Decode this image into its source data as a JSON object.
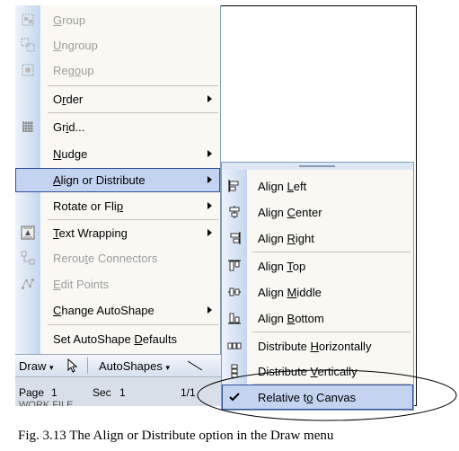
{
  "menu": {
    "items": [
      {
        "label": "Group",
        "key": "G",
        "icon": "group-icon",
        "disabled": true
      },
      {
        "label": "Ungroup",
        "key": "U",
        "icon": "ungroup-icon",
        "disabled": true
      },
      {
        "label": "Regroup",
        "key": "o",
        "icon": "regroup-icon",
        "disabled": true
      },
      {
        "label": "Order",
        "key": "r",
        "submenu": true
      },
      {
        "label": "Grid...",
        "key": "i",
        "icon": "grid-icon"
      },
      {
        "label": "Nudge",
        "key": "N",
        "submenu": true
      },
      {
        "label": "Align or Distribute",
        "key": "A",
        "submenu": true,
        "selected": true
      },
      {
        "label": "Rotate or Flip",
        "key": "p",
        "submenu": true
      },
      {
        "label": "Text Wrapping",
        "key": "T",
        "icon": "text-wrapping-icon",
        "submenu": true
      },
      {
        "label": "Reroute Connectors",
        "key": "t",
        "icon": "reroute-connectors-icon",
        "disabled": true
      },
      {
        "label": "Edit Points",
        "key": "E",
        "icon": "edit-points-icon",
        "disabled": true
      },
      {
        "label": "Change AutoShape",
        "key": "C",
        "submenu": true
      },
      {
        "label": "Set AutoShape Defaults",
        "key": "D"
      }
    ]
  },
  "submenu": {
    "items": [
      {
        "label": "Align Left",
        "key": "L",
        "icon": "align-left-icon"
      },
      {
        "label": "Align Center",
        "key": "C",
        "icon": "align-center-icon"
      },
      {
        "label": "Align Right",
        "key": "R",
        "icon": "align-right-icon"
      },
      {
        "label": "Align Top",
        "key": "T",
        "icon": "align-top-icon"
      },
      {
        "label": "Align Middle",
        "key": "M",
        "icon": "align-middle-icon"
      },
      {
        "label": "Align Bottom",
        "key": "B",
        "icon": "align-bottom-icon"
      },
      {
        "label": "Distribute Horizontally",
        "key": "H",
        "icon": "distribute-horizontally-icon"
      },
      {
        "label": "Distribute Vertically",
        "key": "V",
        "icon": "distribute-vertically-icon"
      },
      {
        "label": "Relative to Canvas",
        "key": "o",
        "icon": "checkmark-icon",
        "selected": true
      }
    ]
  },
  "toolbar": {
    "draw_label": "Draw",
    "autoshapes_label": "AutoShapes"
  },
  "status": {
    "page": "Page",
    "page_num": "1",
    "sec": "Sec",
    "sec_num": "1",
    "position": "1/1",
    "cut_text": "WORK FILE"
  },
  "caption": "Fig. 3.13 The Align or Distribute option in the Draw menu",
  "colors": {
    "highlight": "#c4d3f0",
    "highlight_border": "#31519c",
    "disabled": "#9d9d9d"
  }
}
